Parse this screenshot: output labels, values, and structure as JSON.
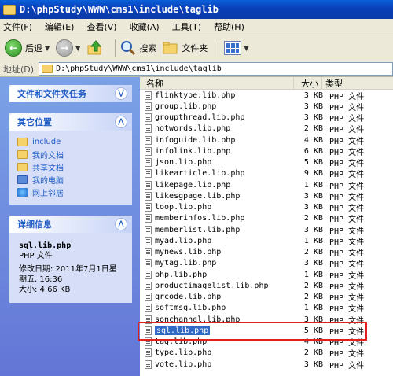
{
  "window": {
    "title": "D:\\phpStudy\\WWW\\cms1\\include\\taglib"
  },
  "menu": [
    "文件(F)",
    "编辑(E)",
    "查看(V)",
    "收藏(A)",
    "工具(T)",
    "帮助(H)"
  ],
  "toolbar": {
    "back": "后退",
    "search": "搜索",
    "folders": "文件夹"
  },
  "address": {
    "label": "地址(D)",
    "path": "D:\\phpStudy\\WWW\\cms1\\include\\taglib"
  },
  "tasks": {
    "title": "文件和文件夹任务"
  },
  "other_places": {
    "title": "其它位置",
    "items": [
      {
        "label": "include",
        "icon": "folder-icon"
      },
      {
        "label": "我的文档",
        "icon": "documents-icon"
      },
      {
        "label": "共享文档",
        "icon": "shared-folder-icon"
      },
      {
        "label": "我的电脑",
        "icon": "computer-icon"
      },
      {
        "label": "网上邻居",
        "icon": "network-icon"
      }
    ]
  },
  "details": {
    "title": "详细信息",
    "name": "sql.lib.php",
    "type": "PHP 文件",
    "modified": "修改日期: 2011年7月1日星期五, 16:36",
    "size": "大小: 4.66 KB"
  },
  "columns": {
    "name": "名称",
    "size": "大小",
    "type": "类型"
  },
  "files": [
    {
      "name": "flinktype.lib.php",
      "size": "3 KB",
      "type": "PHP 文件"
    },
    {
      "name": "group.lib.php",
      "size": "3 KB",
      "type": "PHP 文件"
    },
    {
      "name": "groupthread.lib.php",
      "size": "3 KB",
      "type": "PHP 文件"
    },
    {
      "name": "hotwords.lib.php",
      "size": "2 KB",
      "type": "PHP 文件"
    },
    {
      "name": "infoguide.lib.php",
      "size": "4 KB",
      "type": "PHP 文件"
    },
    {
      "name": "infolink.lib.php",
      "size": "6 KB",
      "type": "PHP 文件"
    },
    {
      "name": "json.lib.php",
      "size": "5 KB",
      "type": "PHP 文件"
    },
    {
      "name": "likearticle.lib.php",
      "size": "9 KB",
      "type": "PHP 文件"
    },
    {
      "name": "likepage.lib.php",
      "size": "1 KB",
      "type": "PHP 文件"
    },
    {
      "name": "likesgpage.lib.php",
      "size": "3 KB",
      "type": "PHP 文件"
    },
    {
      "name": "loop.lib.php",
      "size": "3 KB",
      "type": "PHP 文件"
    },
    {
      "name": "memberinfos.lib.php",
      "size": "2 KB",
      "type": "PHP 文件"
    },
    {
      "name": "memberlist.lib.php",
      "size": "3 KB",
      "type": "PHP 文件"
    },
    {
      "name": "myad.lib.php",
      "size": "1 KB",
      "type": "PHP 文件"
    },
    {
      "name": "mynews.lib.php",
      "size": "2 KB",
      "type": "PHP 文件"
    },
    {
      "name": "mytag.lib.php",
      "size": "3 KB",
      "type": "PHP 文件"
    },
    {
      "name": "php.lib.php",
      "size": "1 KB",
      "type": "PHP 文件"
    },
    {
      "name": "productimagelist.lib.php",
      "size": "2 KB",
      "type": "PHP 文件"
    },
    {
      "name": "qrcode.lib.php",
      "size": "2 KB",
      "type": "PHP 文件"
    },
    {
      "name": "softmsg.lib.php",
      "size": "1 KB",
      "type": "PHP 文件"
    },
    {
      "name": "sonchannel.lib.php",
      "size": "3 KB",
      "type": "PHP 文件"
    },
    {
      "name": "sql.lib.php",
      "size": "5 KB",
      "type": "PHP 文件",
      "selected": true
    },
    {
      "name": "tag.lib.php",
      "size": "4 KB",
      "type": "PHP 文件"
    },
    {
      "name": "type.lib.php",
      "size": "2 KB",
      "type": "PHP 文件"
    },
    {
      "name": "vote.lib.php",
      "size": "3 KB",
      "type": "PHP 文件"
    }
  ],
  "colors": {
    "title_bar": "#0a4fc8",
    "left_pane": "#6f8fdf",
    "selection": "#316ac5",
    "highlight_box": "#e0201e"
  }
}
